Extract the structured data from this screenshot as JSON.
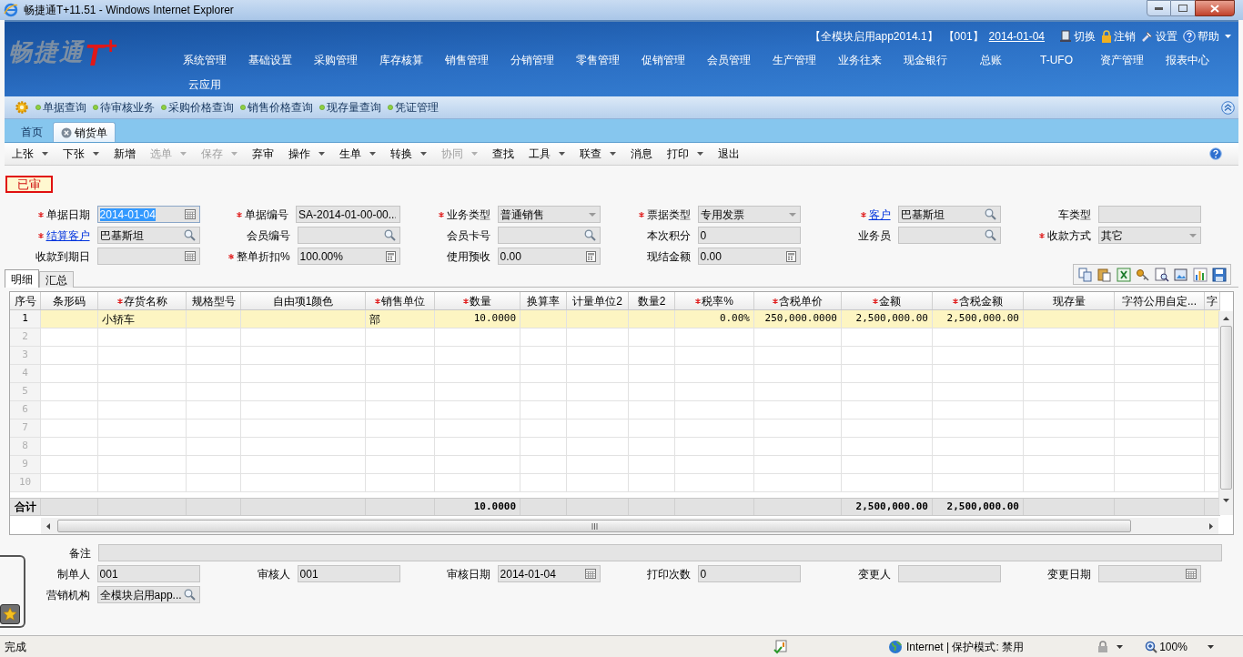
{
  "window": {
    "title": "畅捷通T+11.51 - Windows Internet Explorer"
  },
  "header": {
    "logo": {
      "name": "畅捷通",
      "mark": "T$^{+}$"
    },
    "account_info": [
      {
        "text": "【全模块启用app2014.1】",
        "link": false
      },
      {
        "text": "【001】",
        "link": false
      },
      {
        "text": "2014-01-04",
        "link": true
      }
    ],
    "actions": [
      {
        "label": "切换",
        "kind": "switch"
      },
      {
        "label": "注销",
        "kind": "lock"
      },
      {
        "label": "设置",
        "kind": "settings"
      },
      {
        "label": "帮助",
        "kind": "help"
      }
    ],
    "nav": [
      "系统管理",
      "基础设置",
      "采购管理",
      "库存核算",
      "销售管理",
      "分销管理",
      "零售管理",
      "促销管理",
      "会员管理",
      "生产管理",
      "业务往来",
      "现金银行",
      "总账",
      "T-UFO",
      "资产管理",
      "报表中心",
      "云应用"
    ]
  },
  "quick_links": [
    "单据查询",
    "待审核业务",
    "采购价格查询",
    "销售价格查询",
    "现存量查询",
    "凭证管理"
  ],
  "tabs": [
    {
      "label": "首页",
      "selected": false,
      "closable": false
    },
    {
      "label": "销货单",
      "selected": true,
      "closable": true
    }
  ],
  "toolbar": [
    {
      "label": "上张",
      "dropdown": true,
      "disabled": false
    },
    {
      "label": "下张",
      "dropdown": true,
      "disabled": false
    },
    {
      "label": "新增",
      "dropdown": false,
      "disabled": false
    },
    {
      "label": "选单",
      "dropdown": true,
      "disabled": true
    },
    {
      "label": "保存",
      "dropdown": true,
      "disabled": true
    },
    {
      "label": "弃审",
      "dropdown": false,
      "disabled": false
    },
    {
      "label": "操作",
      "dropdown": true,
      "disabled": false
    },
    {
      "label": "生单",
      "dropdown": true,
      "disabled": false
    },
    {
      "label": "转换",
      "dropdown": true,
      "disabled": false
    },
    {
      "label": "协同",
      "dropdown": true,
      "disabled": true
    },
    {
      "label": "查找",
      "dropdown": false,
      "disabled": false
    },
    {
      "label": "工具",
      "dropdown": true,
      "disabled": false
    },
    {
      "label": "联查",
      "dropdown": true,
      "disabled": false
    },
    {
      "label": "消息",
      "dropdown": false,
      "disabled": false
    },
    {
      "label": "打印",
      "dropdown": true,
      "disabled": false
    },
    {
      "label": "退出",
      "dropdown": false,
      "disabled": false
    }
  ],
  "status_badge": "已审",
  "form": [
    [
      {
        "label": "单据日期",
        "required": true,
        "link": false,
        "kind": "date",
        "value": "2014-01-04",
        "text_selected": true
      },
      {
        "label": "单据编号",
        "required": true,
        "link": false,
        "kind": "text",
        "value": "SA-2014-01-00-00...",
        "text_selected": false
      },
      {
        "label": "业务类型",
        "required": true,
        "link": false,
        "kind": "select",
        "value": "普通销售",
        "text_selected": false
      },
      {
        "label": "票据类型",
        "required": true,
        "link": false,
        "kind": "select",
        "value": "专用发票",
        "text_selected": false
      },
      {
        "label": "客户",
        "required": true,
        "link": true,
        "kind": "search",
        "value": "巴基斯坦",
        "text_selected": false
      },
      {
        "label": "车类型",
        "required": false,
        "link": false,
        "kind": "text",
        "text_selected": false
      }
    ],
    [
      {
        "label": "结算客户",
        "required": true,
        "link": true,
        "kind": "search",
        "value": "巴基斯坦",
        "text_selected": false
      },
      {
        "label": "会员编号",
        "required": false,
        "link": false,
        "kind": "search",
        "text_selected": false
      },
      {
        "label": "会员卡号",
        "required": false,
        "link": false,
        "kind": "search",
        "text_selected": false
      },
      {
        "label": "本次积分",
        "required": false,
        "link": false,
        "kind": "text",
        "value": "0",
        "text_selected": false
      },
      {
        "label": "业务员",
        "required": false,
        "link": false,
        "kind": "search",
        "text_selected": false
      },
      {
        "label": "收款方式",
        "required": true,
        "link": false,
        "kind": "select",
        "value": "其它",
        "text_selected": false
      }
    ],
    [
      {
        "label": "收款到期日",
        "required": false,
        "link": false,
        "kind": "date",
        "text_selected": false
      },
      {
        "label": "整单折扣%",
        "required": true,
        "link": false,
        "kind": "calc",
        "value": "100.00%",
        "text_selected": false
      },
      {
        "label": "使用预收",
        "required": false,
        "link": false,
        "kind": "calc",
        "value": "0.00",
        "text_selected": false
      },
      {
        "label": "现结金额",
        "required": false,
        "link": false,
        "kind": "calc",
        "value": "0.00",
        "text_selected": false
      }
    ]
  ],
  "detail_tabs": [
    {
      "label": "明细",
      "selected": true
    },
    {
      "label": "汇总",
      "selected": false
    }
  ],
  "grid_tools": [
    {
      "kind": "copy"
    },
    {
      "kind": "paste"
    },
    {
      "kind": "excel"
    },
    {
      "kind": "key"
    },
    {
      "kind": "preview"
    },
    {
      "kind": "image"
    },
    {
      "kind": "chart"
    },
    {
      "kind": "save"
    }
  ],
  "table": {
    "columns": [
      {
        "label": "序号",
        "required": false,
        "kind": "index"
      },
      {
        "label": "条形码",
        "required": false,
        "kind": "text"
      },
      {
        "label": "存货名称",
        "required": true,
        "kind": "text"
      },
      {
        "label": "规格型号",
        "required": false,
        "kind": "text"
      },
      {
        "label": "自由项1颜色",
        "required": false,
        "kind": "text"
      },
      {
        "label": "销售单位",
        "required": true,
        "kind": "text"
      },
      {
        "label": "数量",
        "required": true,
        "kind": "number"
      },
      {
        "label": "换算率",
        "required": false,
        "kind": "number"
      },
      {
        "label": "计量单位2",
        "required": false,
        "kind": "text"
      },
      {
        "label": "数量2",
        "required": false,
        "kind": "number"
      },
      {
        "label": "税率%",
        "required": true,
        "kind": "number"
      },
      {
        "label": "含税单价",
        "required": true,
        "kind": "number"
      },
      {
        "label": "金额",
        "required": true,
        "kind": "number"
      },
      {
        "label": "含税金额",
        "required": true,
        "kind": "number"
      },
      {
        "label": "现存量",
        "required": false,
        "kind": "number"
      },
      {
        "label": "字符公用自定...",
        "required": false,
        "kind": "text"
      },
      {
        "label": "字",
        "required": false
      }
    ],
    "rows": [
      {
        "number": "1",
        "selected": true,
        "item": "小轿车",
        "unit": "部",
        "qty": "10.0000",
        "tax_rate": "0.00%",
        "price": "250,000.0000",
        "amount": "2,500,000.00",
        "amount_tax": "2,500,000.00"
      },
      {
        "number": "2",
        "selected": false
      },
      {
        "number": "3",
        "selected": false
      },
      {
        "number": "4",
        "selected": false
      },
      {
        "number": "5",
        "selected": false
      },
      {
        "number": "6",
        "selected": false
      },
      {
        "number": "7",
        "selected": false
      },
      {
        "number": "8",
        "selected": false
      },
      {
        "number": "9",
        "selected": false
      },
      {
        "number": "10",
        "selected": false
      }
    ],
    "totals": {
      "number": "合计",
      "qty": "10.0000",
      "amount": "2,500,000.00",
      "amount_tax": "2,500,000.00"
    }
  },
  "footer": {
    "remark_label": "备注",
    "fields": [
      {
        "label": "制单人",
        "kind": "text",
        "value": "001"
      },
      {
        "label": "审核人",
        "kind": "text",
        "value": "001"
      },
      {
        "label": "审核日期",
        "kind": "date",
        "value": "2014-01-04"
      },
      {
        "label": "打印次数",
        "kind": "text",
        "value": "0"
      },
      {
        "label": "变更人",
        "kind": "text"
      },
      {
        "label": "变更日期",
        "kind": "date"
      },
      {
        "label": "营销机构",
        "kind": "search",
        "value": "全模块启用app..."
      }
    ]
  },
  "status_bar": {
    "text": "完成",
    "zone": "Internet | 保护模式: 禁用",
    "zoom": "100%"
  }
}
